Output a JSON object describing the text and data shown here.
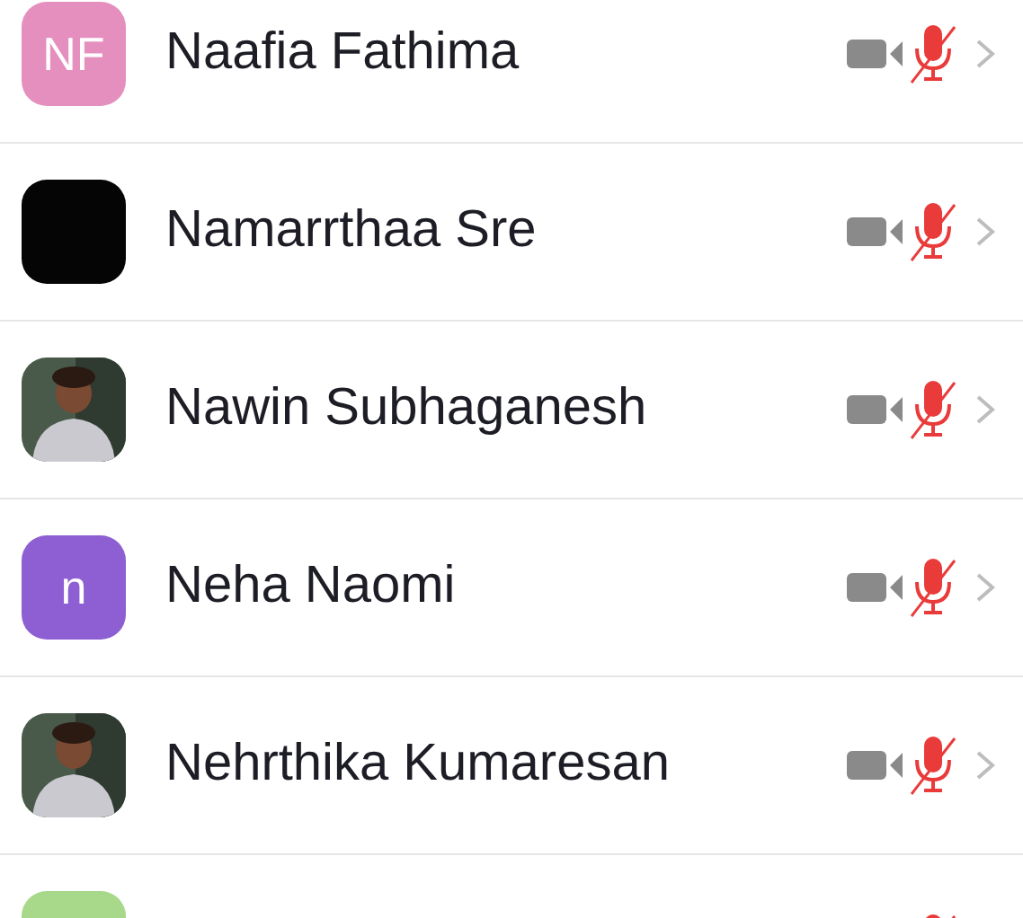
{
  "participants": [
    {
      "name": "Naafia Fathima",
      "avatar": {
        "kind": "initials",
        "initials": "NF",
        "color": "#e58fbf"
      },
      "muted": true
    },
    {
      "name": "Namarrthaa Sre",
      "avatar": {
        "kind": "blank",
        "color": "#050505"
      },
      "muted": true
    },
    {
      "name": "Nawin Subhaganesh",
      "muted": true
    },
    {
      "name": "Neha Naomi",
      "avatar": {
        "kind": "initials",
        "initials": "n",
        "color": "#8d5fd3"
      },
      "muted": true
    },
    {
      "name": "Nehrthika Kumaresan",
      "muted": true
    },
    {
      "avatar": {
        "kind": "blank",
        "color": "#a8d98a"
      },
      "muted": true
    }
  ]
}
